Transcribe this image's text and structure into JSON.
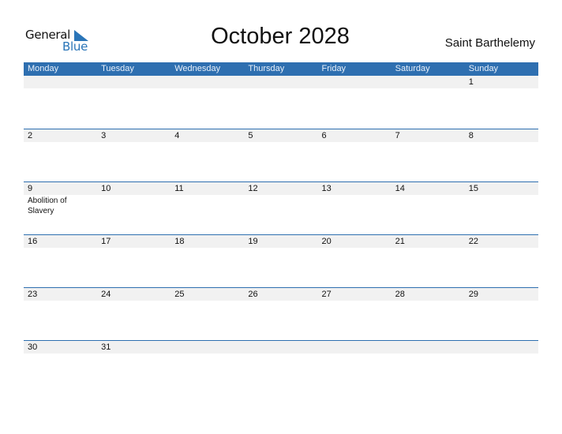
{
  "logo": {
    "part1": "General",
    "part2": "Blue",
    "accent_color": "#2a75b8"
  },
  "title": "October 2028",
  "region": "Saint Barthelemy",
  "header_color": "#2e6fb0",
  "days": [
    "Monday",
    "Tuesday",
    "Wednesday",
    "Thursday",
    "Friday",
    "Saturday",
    "Sunday"
  ],
  "weeks": [
    [
      {
        "d": ""
      },
      {
        "d": ""
      },
      {
        "d": ""
      },
      {
        "d": ""
      },
      {
        "d": ""
      },
      {
        "d": ""
      },
      {
        "d": "1"
      }
    ],
    [
      {
        "d": "2"
      },
      {
        "d": "3"
      },
      {
        "d": "4"
      },
      {
        "d": "5"
      },
      {
        "d": "6"
      },
      {
        "d": "7"
      },
      {
        "d": "8"
      }
    ],
    [
      {
        "d": "9",
        "e": "Abolition of Slavery"
      },
      {
        "d": "10"
      },
      {
        "d": "11"
      },
      {
        "d": "12"
      },
      {
        "d": "13"
      },
      {
        "d": "14"
      },
      {
        "d": "15"
      }
    ],
    [
      {
        "d": "16"
      },
      {
        "d": "17"
      },
      {
        "d": "18"
      },
      {
        "d": "19"
      },
      {
        "d": "20"
      },
      {
        "d": "21"
      },
      {
        "d": "22"
      }
    ],
    [
      {
        "d": "23"
      },
      {
        "d": "24"
      },
      {
        "d": "25"
      },
      {
        "d": "26"
      },
      {
        "d": "27"
      },
      {
        "d": "28"
      },
      {
        "d": "29"
      }
    ],
    [
      {
        "d": "30"
      },
      {
        "d": "31"
      },
      {
        "d": ""
      },
      {
        "d": ""
      },
      {
        "d": ""
      },
      {
        "d": ""
      },
      {
        "d": ""
      }
    ]
  ]
}
